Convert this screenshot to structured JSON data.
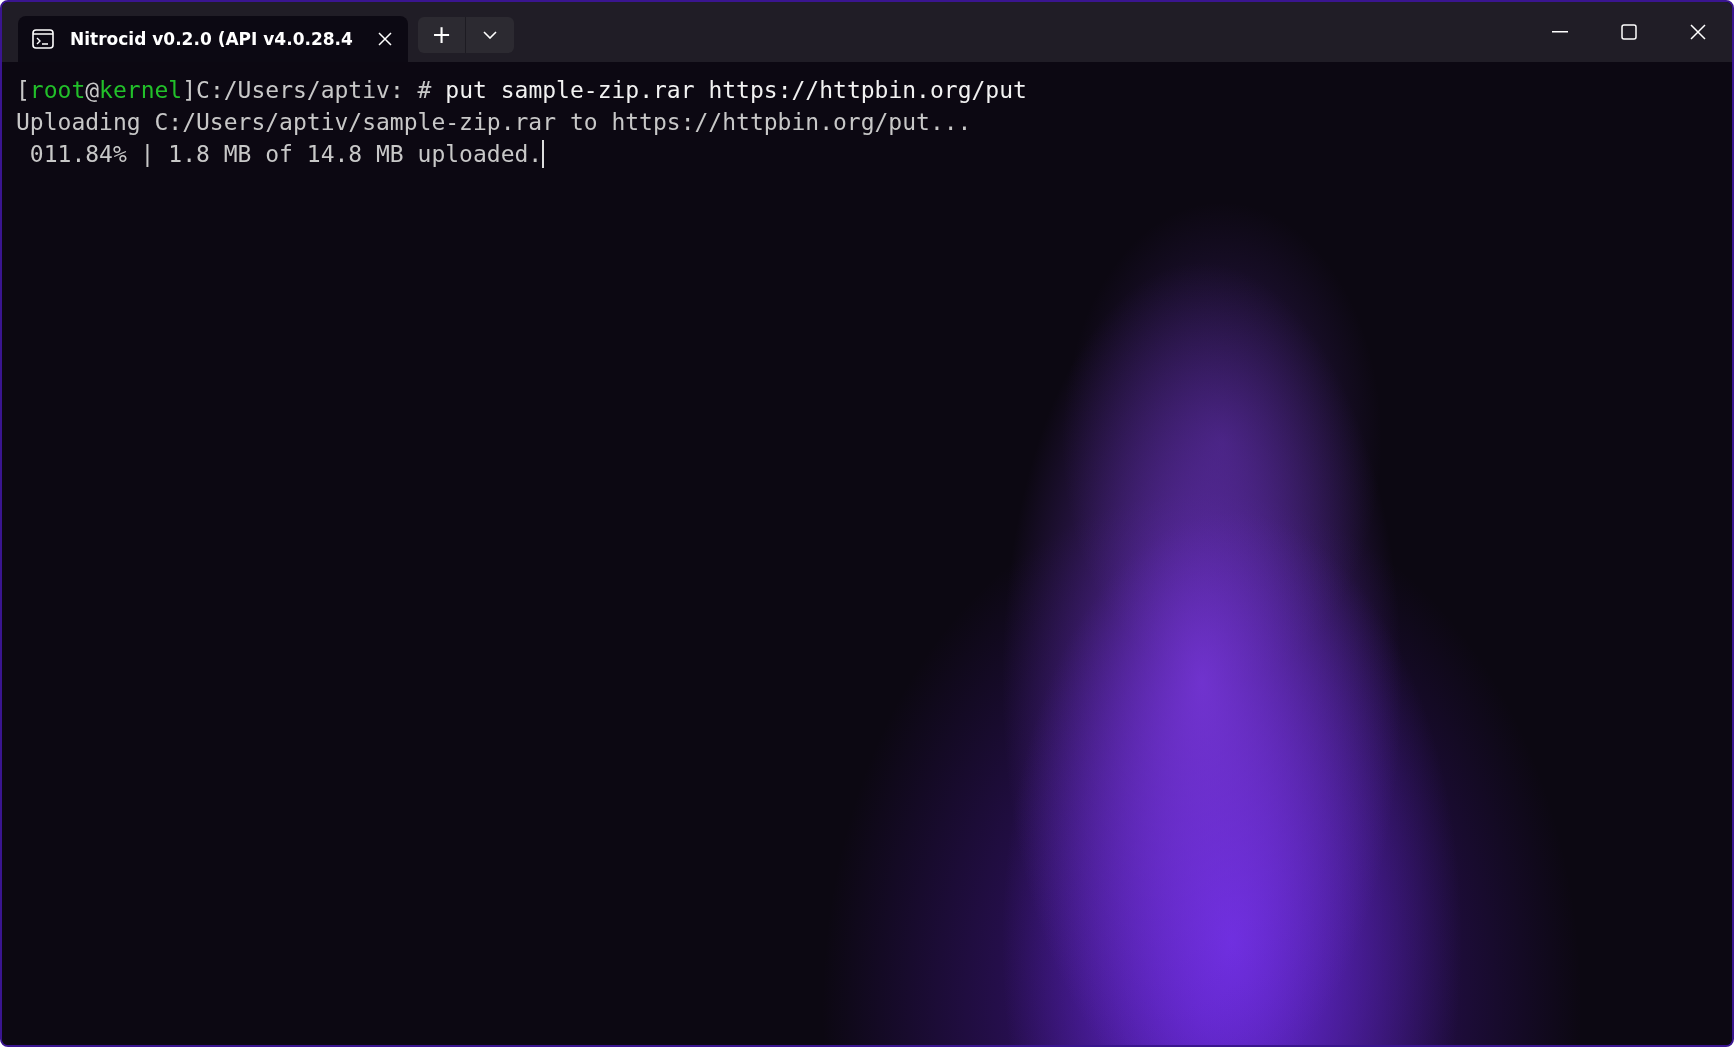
{
  "tabs": [
    {
      "title": "Nitrocid v0.2.0 (API v4.0.28.4",
      "selected": true
    }
  ],
  "new_tab_button": "+",
  "terminal_lines": [
    {
      "segments": [
        {
          "text": "[",
          "color": "#c8c8c8"
        },
        {
          "text": "root",
          "color": "#22c02a"
        },
        {
          "text": "@",
          "color": "#c8c8c8"
        },
        {
          "text": "kernel",
          "color": "#22c02a"
        },
        {
          "text": "]C:/Users/aptiv: # ",
          "color": "#c8c8c8"
        },
        {
          "text": "put sample-zip.rar https://httpbin.org/put",
          "color": "#f2f2f2"
        }
      ]
    },
    {
      "segments": [
        {
          "text": "Uploading C:/Users/aptiv/sample-zip.rar to https://httpbin.org/put...",
          "color": "#c8c8c8"
        }
      ]
    },
    {
      "segments": [
        {
          "text": " 011.84% | 1.8 MB of 14.8 MB uploaded.",
          "color": "#c8c8c8"
        }
      ]
    }
  ]
}
